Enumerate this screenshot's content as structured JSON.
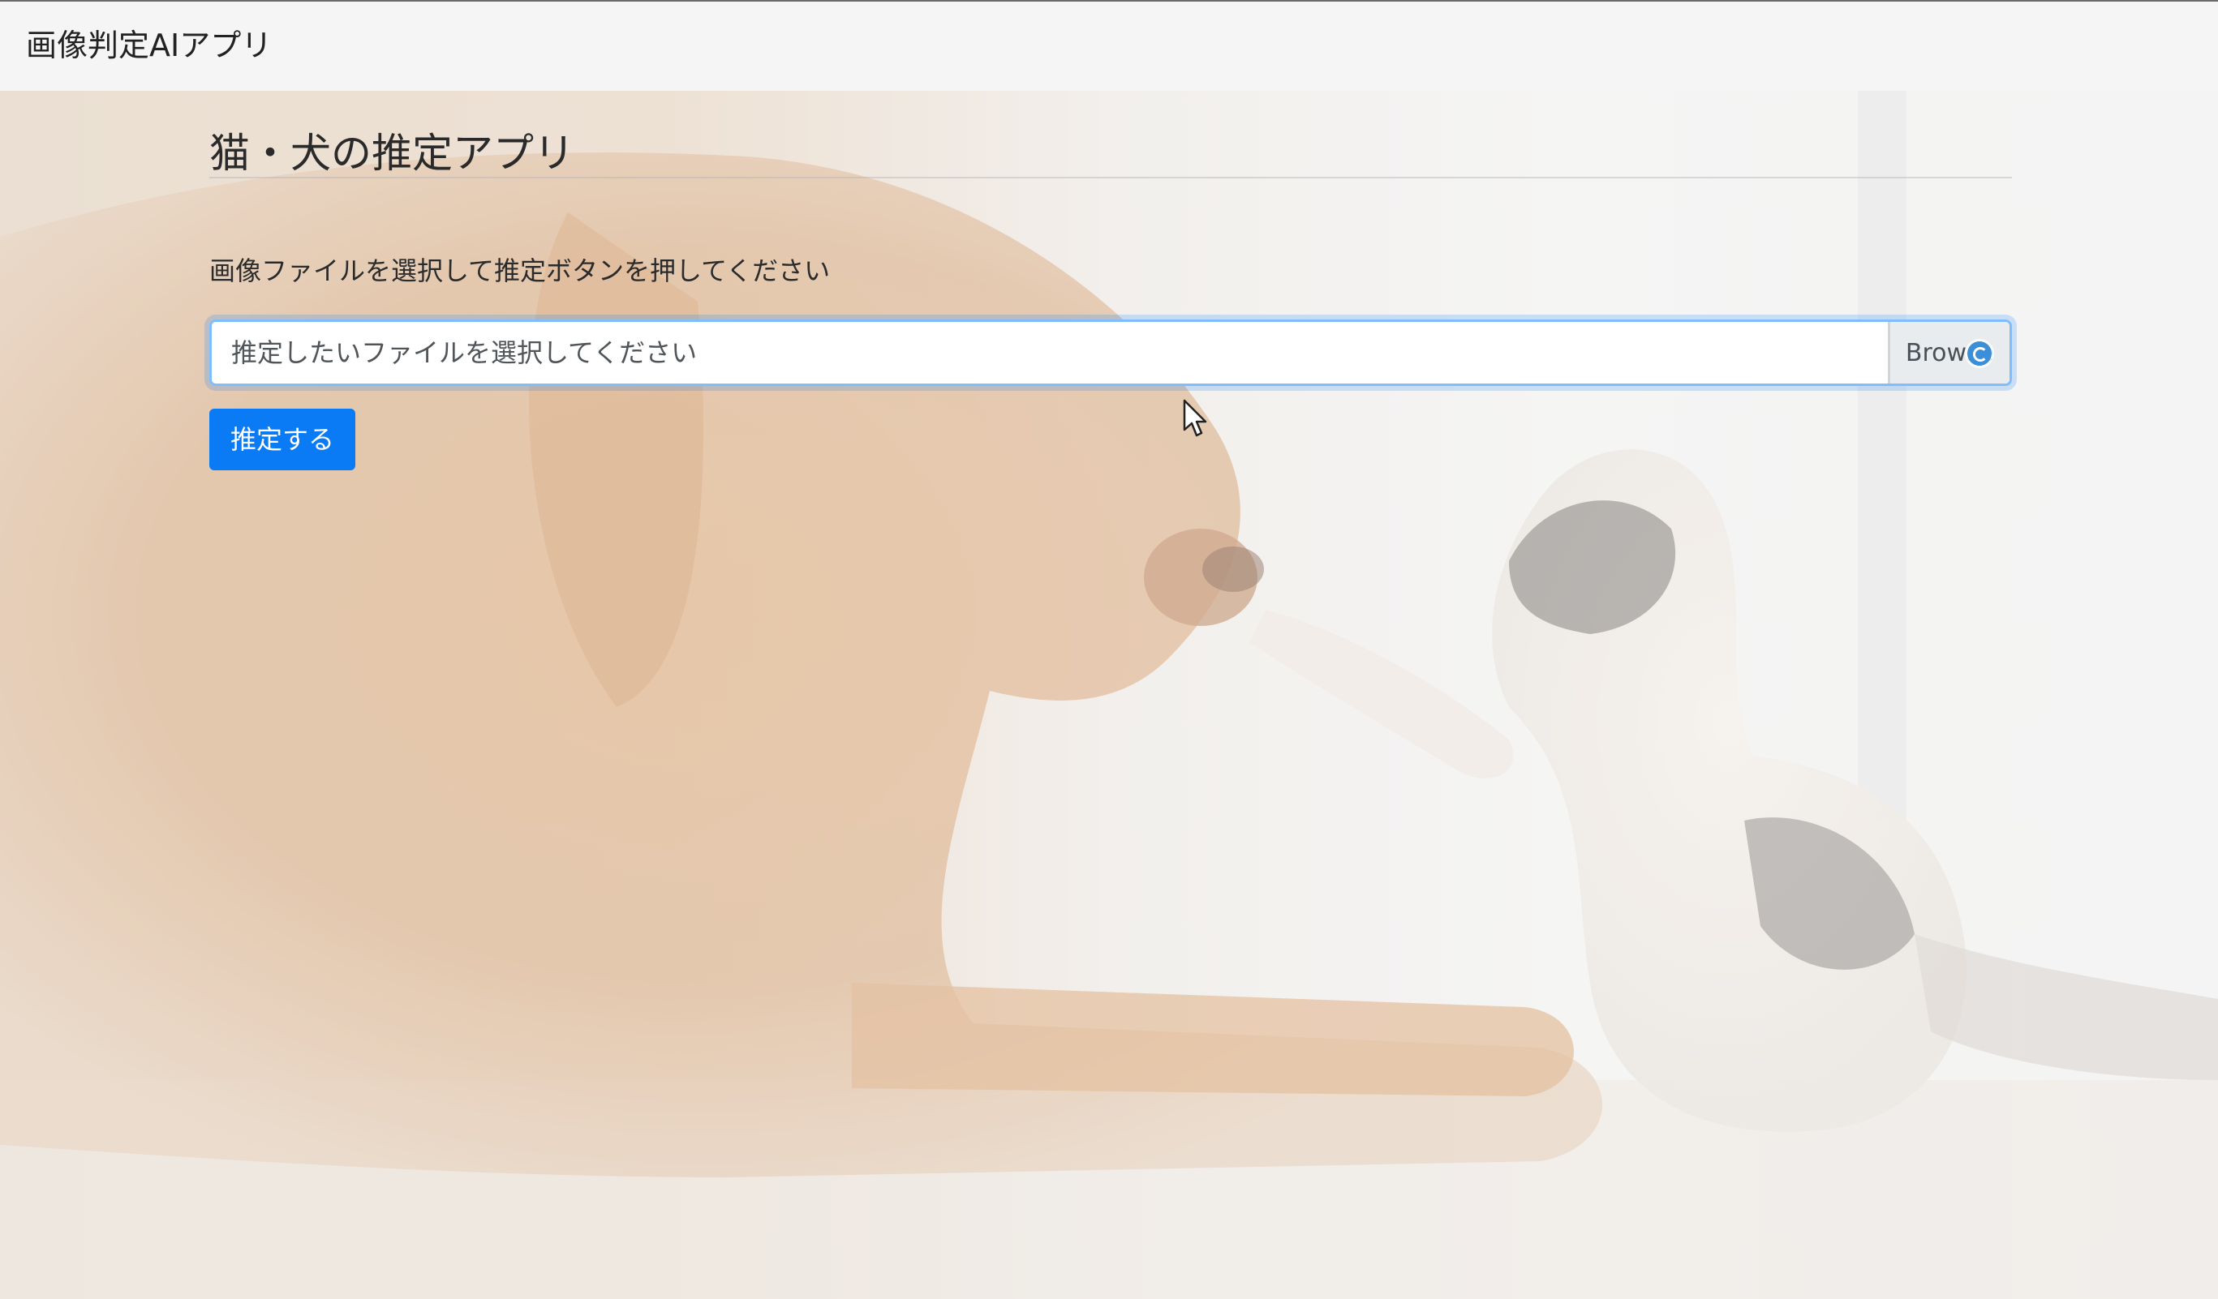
{
  "navbar": {
    "brand": "画像判定AIアプリ"
  },
  "main": {
    "title": "猫・犬の推定アプリ",
    "instruction": "画像ファイルを選択して推定ボタンを押してください",
    "file_input": {
      "placeholder": "推定したいファイルを選択してください",
      "value": "",
      "browse_label": "Browse"
    },
    "submit_label": "推定する"
  },
  "background": {
    "subject": "dog-and-kitten-photo"
  },
  "colors": {
    "primary": "#0b7bf5",
    "focus_ring": "#80bdff",
    "navbar_bg": "#f5f5f5"
  },
  "icons": {
    "cursor": "mouse-pointer-icon",
    "busy": "loading-spinner-icon"
  }
}
